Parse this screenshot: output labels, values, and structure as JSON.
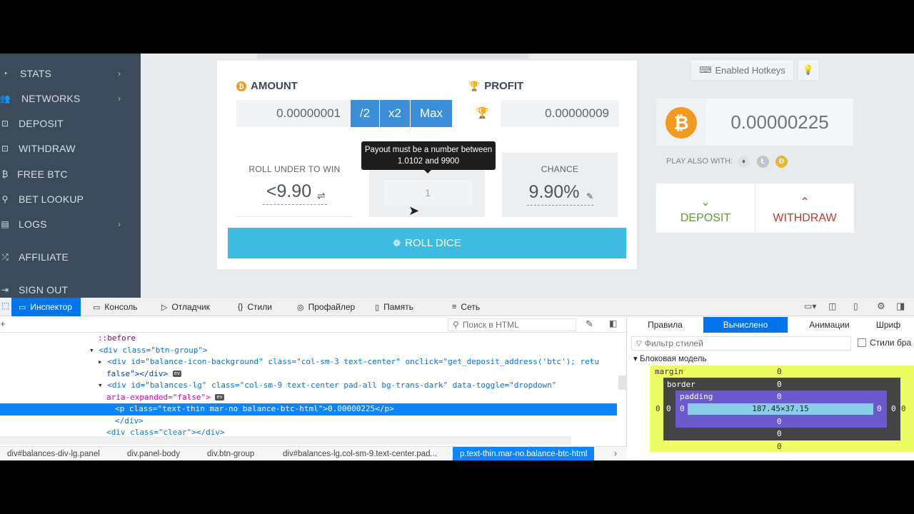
{
  "sidebar": {
    "items": [
      {
        "label": "STATS",
        "icon": "pie-chart-icon",
        "chevron": true
      },
      {
        "label": "NETWORKS",
        "icon": "users-icon",
        "chevron": true
      },
      {
        "label": "DEPOSIT",
        "icon": "deposit-icon",
        "chevron": false
      },
      {
        "label": "WITHDRAW",
        "icon": "withdraw-icon",
        "chevron": false
      },
      {
        "label": "FREE BTC",
        "icon": "bitcoin-icon",
        "chevron": false
      },
      {
        "label": "BET LOOKUP",
        "icon": "search-icon",
        "chevron": false
      },
      {
        "label": "LOGS",
        "icon": "book-icon",
        "chevron": true
      },
      {
        "label": "AFFILIATE",
        "icon": "shuffle-icon",
        "chevron": false
      },
      {
        "label": "SIGN OUT",
        "icon": "signout-icon",
        "chevron": false
      }
    ]
  },
  "amount": {
    "title": "AMOUNT",
    "value": "0.00000001",
    "half_label": "/2",
    "double_label": "x2",
    "max_label": "Max"
  },
  "profit": {
    "title": "PROFIT",
    "value": "0.00000009"
  },
  "roll_under": {
    "label": "ROLL UNDER TO WIN",
    "value": "<9.90"
  },
  "payout": {
    "input_value": "1",
    "tooltip": "Payout must be a number between 1.0102 and 9900"
  },
  "chance": {
    "label": "CHANCE",
    "value": "9.90%"
  },
  "roll_button": "ROLL DICE",
  "hotkeys_label": "Enabled Hotkeys",
  "balance": {
    "value": "0.00000225",
    "coin": "BTC"
  },
  "play_also": "PLAY ALSO WITH:",
  "deposit_label": "DEPOSIT",
  "withdraw_label": "WITHDRAW",
  "colors": {
    "bitcoin": "#f39a21",
    "accent_blue": "#3b8fd8",
    "roll": "#3dbbe0",
    "deposit": "#5aa02c",
    "withdraw": "#c0392b"
  },
  "devtools": {
    "tabs": [
      "Инспектор",
      "Консоль",
      "Отладчик",
      "Стили",
      "Профайлер",
      "Память",
      "Сеть"
    ],
    "search_placeholder": "Поиск в HTML",
    "code_lines": [
      "::before",
      "<div class=\"btn-group\">",
      "<div id=\"balance-icon-background\" class=\"col-sm-3 text-center\" onclick=\"get_deposit_address('btc'); retu",
      "false\"></div>",
      "<div id=\"balances-lg\" class=\"col-sm-9 text-center pad-all bg-trans-dark\" data-toggle=\"dropdown\"",
      "aria-expanded=\"false\">",
      "<p class=\"text-thin mar-no balance-btc-html\">0.00000225</p>",
      "</div>",
      "<div class=\"clear\"></div>"
    ],
    "breadcrumb": [
      "div#balances-div-lg.panel",
      "div.panel-body",
      "div.btn-group",
      "div#balances-lg.col-sm-9.text-center.pad...",
      "p.text-thin.mar-no.balance-btc-html"
    ],
    "right_tabs": [
      "Правила",
      "Вычислено",
      "Анимации",
      "Шриф"
    ],
    "filter_placeholder": "Фильтр стилей",
    "browser_styles_label": "Стили бра",
    "box_model_title": "Блоковая модель",
    "box_model": {
      "margin_label": "margin",
      "border_label": "border",
      "padding_label": "padding",
      "margin": "0",
      "border": "0",
      "padding": "0",
      "content": "187.45×37.15"
    }
  }
}
